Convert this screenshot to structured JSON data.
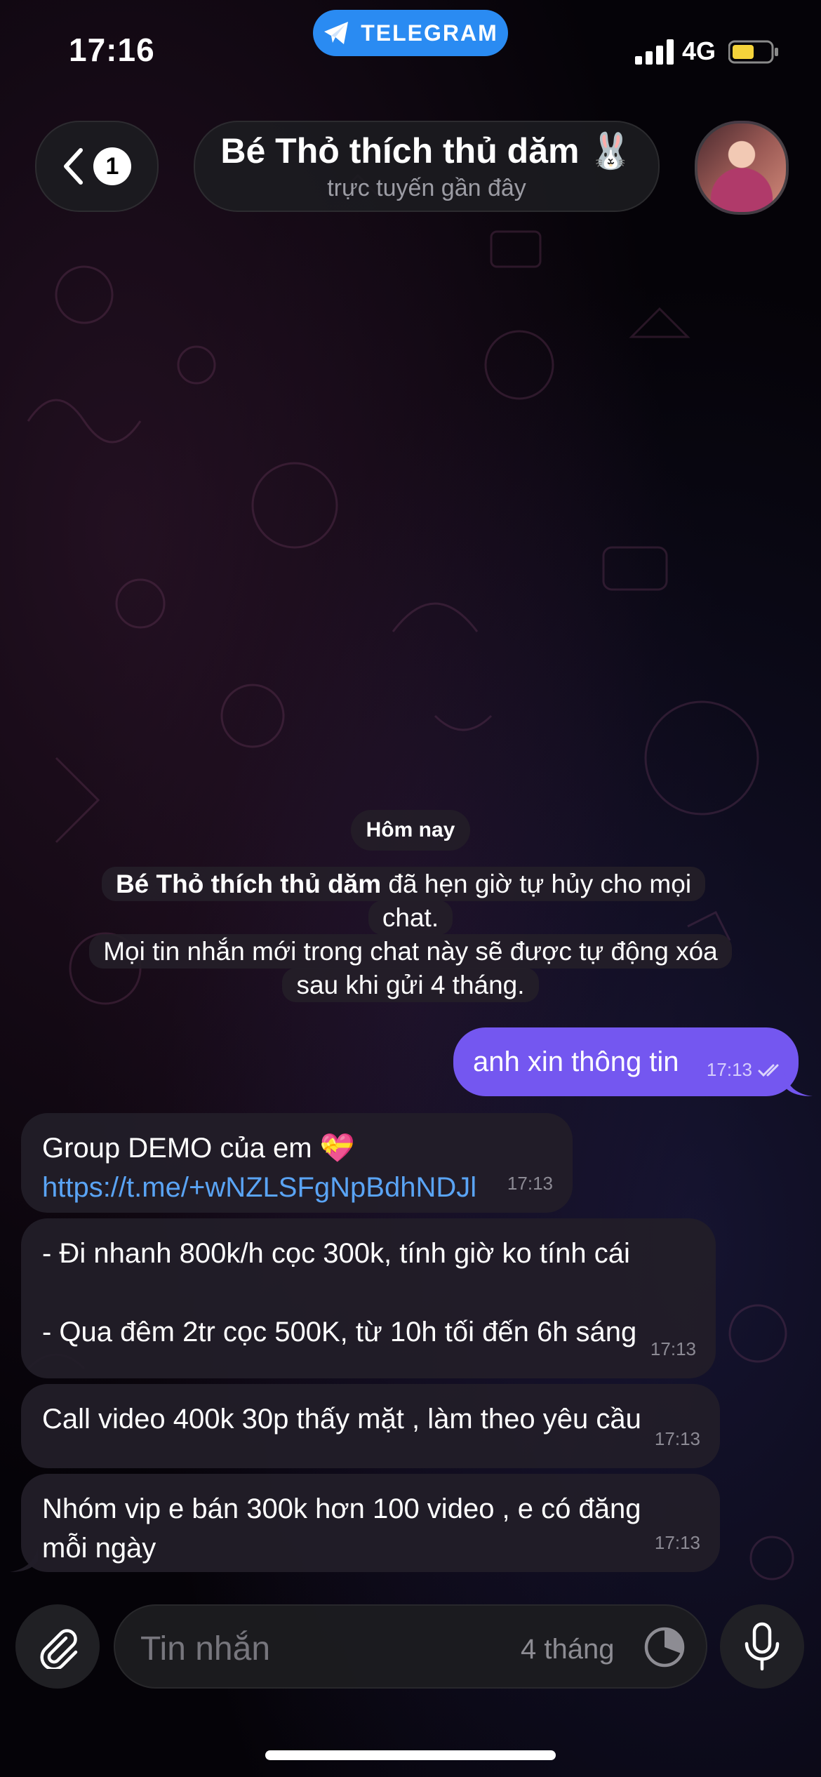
{
  "status_bar": {
    "time": "17:16",
    "app_pill": "TELEGRAM",
    "network": "4G"
  },
  "header": {
    "back_badge": "1",
    "title": "Bé Thỏ thích thủ dăm 🐰",
    "subtitle": "trực tuyến gần đây"
  },
  "date_divider": "Hôm nay",
  "service_message": {
    "sender": "Bé Thỏ thích thủ dăm",
    "line1_rest": " đã hẹn giờ tự hủy cho mọi chat.",
    "line2": "Mọi tin nhắn mới trong chat này sẽ được tự động xóa sau khi gửi 4 tháng."
  },
  "messages": [
    {
      "direction": "out",
      "text": "anh xin thông tin",
      "time": "17:13"
    },
    {
      "direction": "in",
      "text": "Group DEMO của em 💝",
      "link": "https://t.me/+wNZLSFgNpBdhNDJl",
      "time": "17:13"
    },
    {
      "direction": "in",
      "line1": "- Đi nhanh 800k/h cọc 300k, tính giờ ko tính cái",
      "line2": "- Qua đêm 2tr cọc 500K, từ 10h tối đến 6h sáng",
      "time": "17:13"
    },
    {
      "direction": "in",
      "text": "Call video 400k 30p thấy mặt , làm theo yêu cầu",
      "time": "17:13"
    },
    {
      "direction": "in",
      "text": "Nhóm vip e bán 300k hơn 100 video , e có đăng mỗi ngày",
      "time": "17:13"
    }
  ],
  "composer": {
    "placeholder": "Tin nhắn",
    "timer_label": "4 tháng"
  },
  "colors": {
    "outgoing_bubble": "#7457f0",
    "incoming_bubble": "#221e28",
    "link": "#5aa4f5",
    "telegram_pill": "#2a8bf2"
  },
  "icons": [
    "telegram-plane-icon",
    "signal-icon",
    "battery-icon",
    "back-chevron-icon",
    "read-check-icon",
    "paperclip-icon",
    "clock-timer-icon",
    "microphone-icon"
  ]
}
